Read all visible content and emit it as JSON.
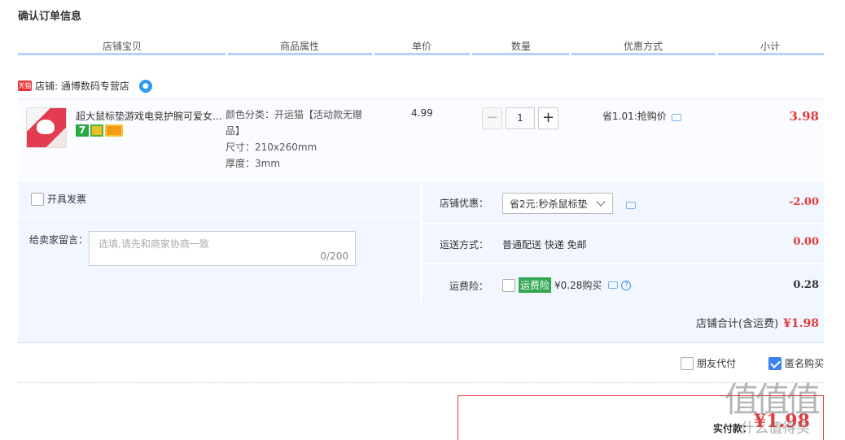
{
  "page_title": "确认订单信息",
  "columns": [
    "店铺宝贝",
    "商品属性",
    "单价",
    "数量",
    "优惠方式",
    "小计"
  ],
  "shop": {
    "badge": "天猫",
    "label": "店铺: 通博数码专营店"
  },
  "item": {
    "name": "超大鼠标垫游戏电竞护腕可爱女...",
    "badge7": "7",
    "attributes": [
      "颜色分类：开运猫【活动款无赠",
      "品】",
      "尺寸：210x260mm",
      "厚度：3mm"
    ],
    "unit_price": "4.99",
    "quantity": "1",
    "minus": "−",
    "plus": "+",
    "promotion": "省1.01:抢购价",
    "subtotal": "3.98"
  },
  "options": {
    "invoice_label": "开具发票",
    "message_label": "给卖家留言：",
    "message_placeholder": "选填,请先和商家协商一致",
    "message_count": "0/200",
    "shop_discount_label": "店铺优惠：",
    "shop_discount_value": "省2元:秒杀鼠标垫",
    "shop_discount_amount": "-2.00",
    "shipping_label": "运送方式：",
    "shipping_value": "普通配送 快递 免邮",
    "shipping_amount": "0.00",
    "insurance_label": "运费险：",
    "insurance_tag": "运费险",
    "insurance_text": "¥0.28购买",
    "insurance_amount": "0.28"
  },
  "shop_total": {
    "label": "店铺合计(含运费)",
    "amount": "¥1.98"
  },
  "friend_pay": "朋友代付",
  "anonymous": "匿名购买",
  "pay": {
    "label": "实付款：",
    "amount": "¥1.98"
  },
  "watermark": {
    "big": "值值值",
    "small": "什么值得买"
  },
  "colors": {
    "accent_red": "#e4393c",
    "header_rule": "#b2d1ff",
    "panel_bg": "#f2f7ff",
    "check_blue": "#3b82f6",
    "insurance_green": "#34a853"
  }
}
